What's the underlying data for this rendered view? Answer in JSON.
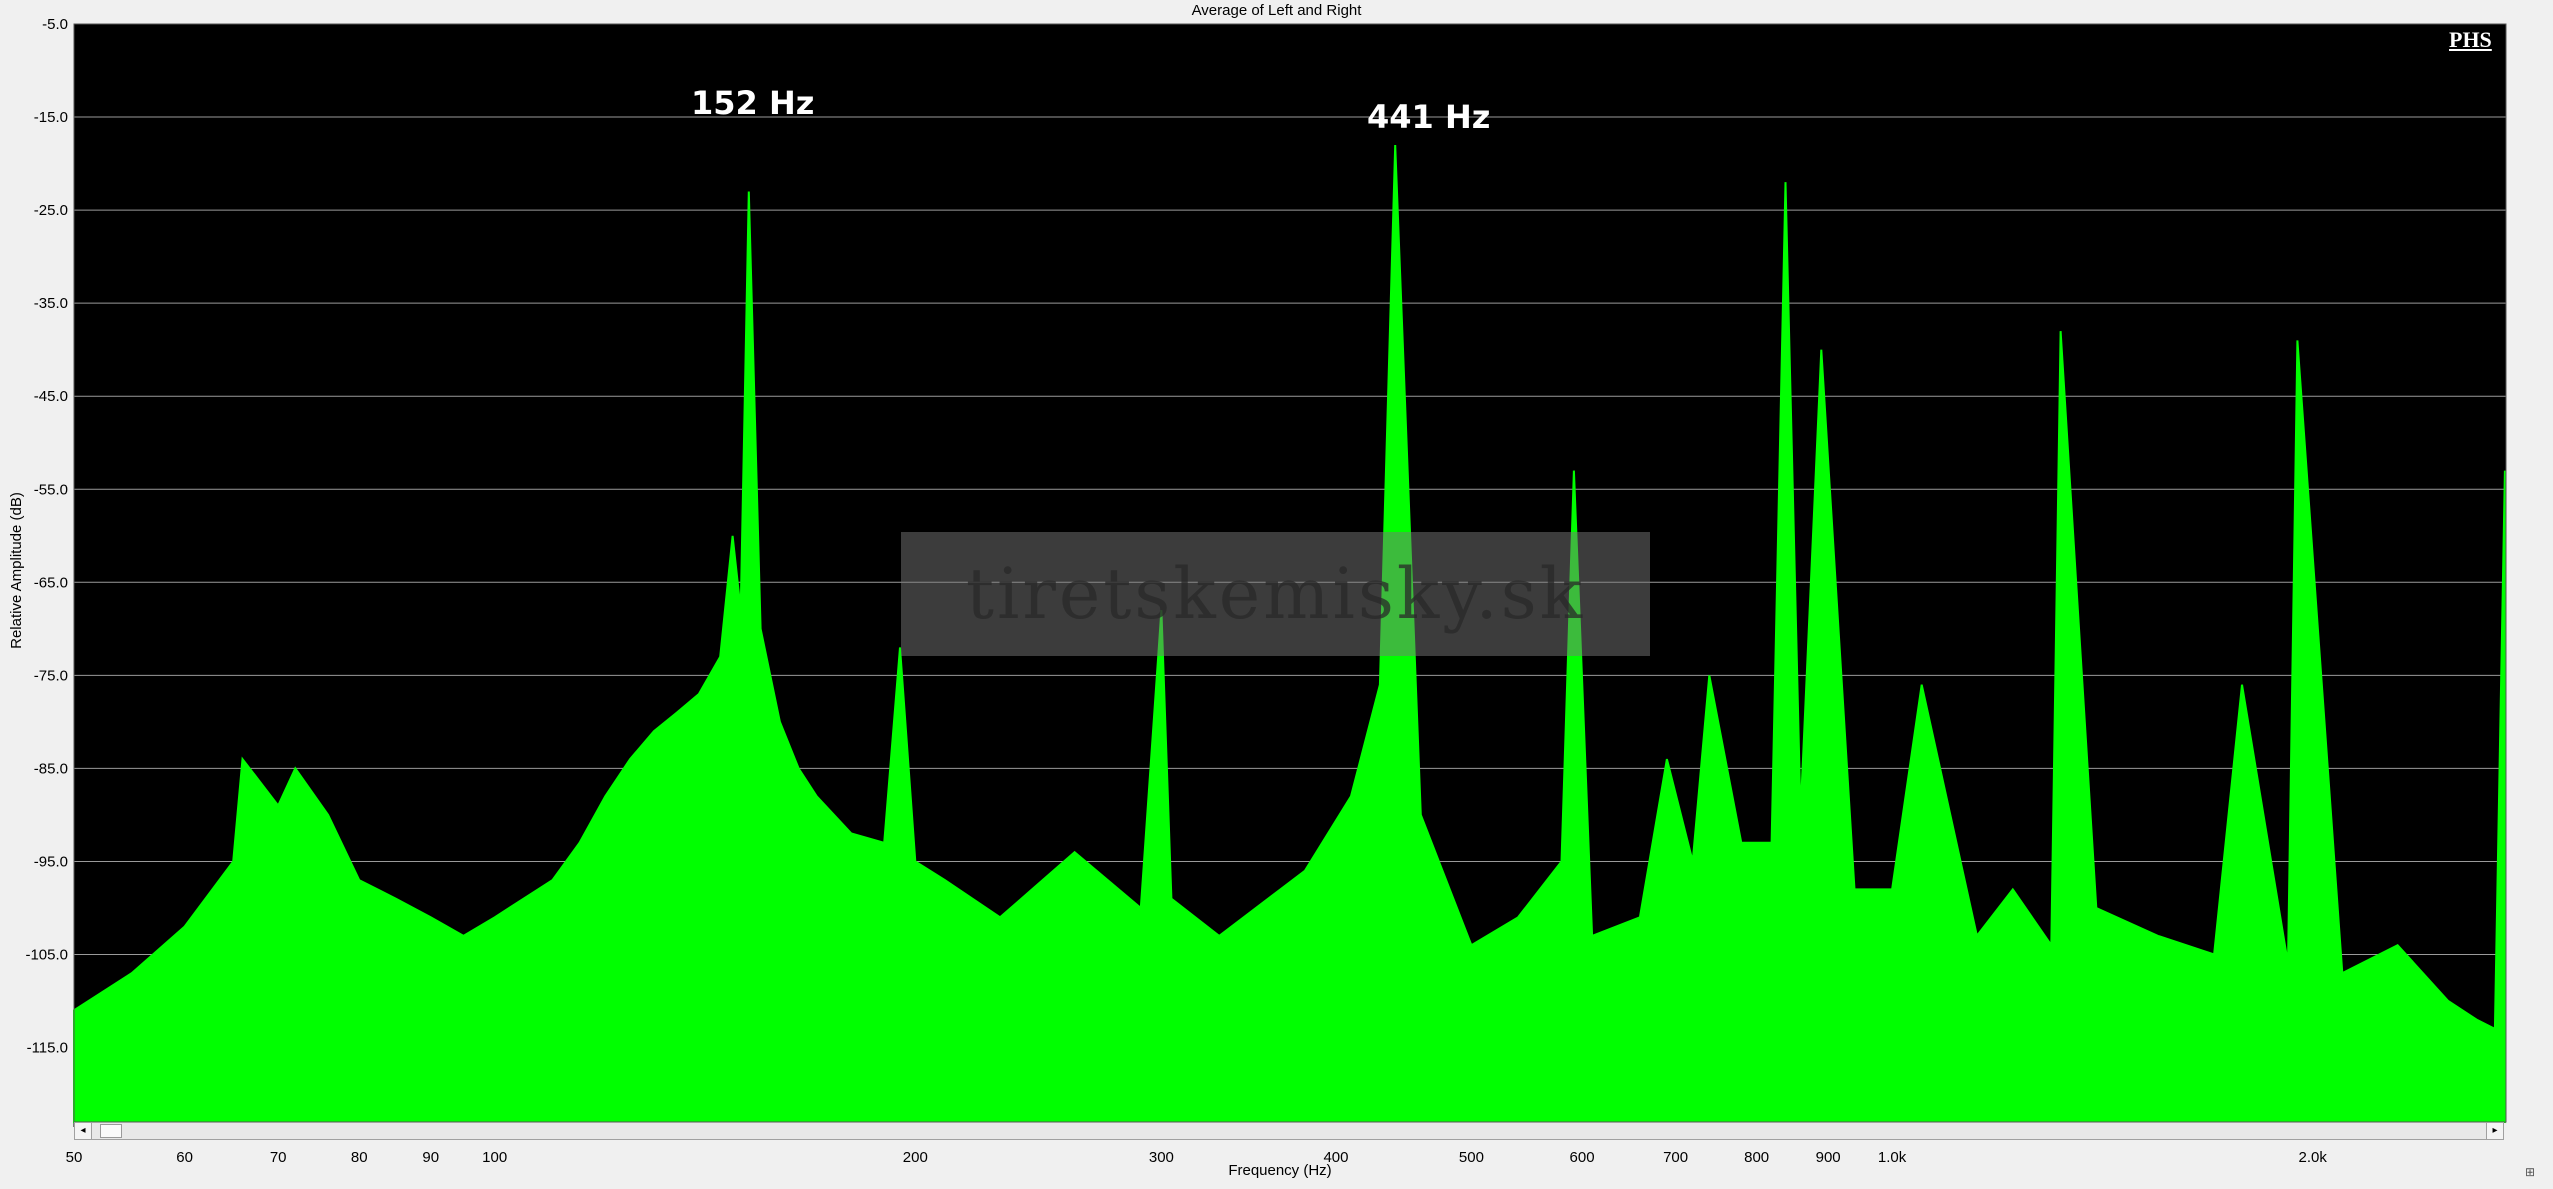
{
  "chart_data": {
    "type": "area",
    "title": "Average of Left and Right",
    "xlabel": "Frequency (Hz)",
    "ylabel": "Relative Amplitude (dB)",
    "x_scale": "log",
    "xlim": [
      50,
      2750
    ],
    "ylim": [
      -123,
      -5
    ],
    "y_ticks": [
      "-5.0",
      "-15.0",
      "-25.0",
      "-35.0",
      "-45.0",
      "-55.0",
      "-65.0",
      "-75.0",
      "-85.0",
      "-95.0",
      "-105.0",
      "-115.0"
    ],
    "x_ticks": [
      "50",
      "60",
      "70",
      "80",
      "90",
      "100",
      "200",
      "300",
      "400",
      "500",
      "600",
      "700",
      "800",
      "900",
      "1.0k",
      "2.0k"
    ],
    "grid": "horizontal",
    "series": [
      {
        "color": "#00ff00",
        "x": [
          50,
          55,
          60,
          65,
          66,
          70,
          72,
          76,
          80,
          85,
          90,
          95,
          100,
          110,
          115,
          120,
          125,
          130,
          135,
          140,
          145,
          148,
          150,
          152,
          155,
          160,
          165,
          170,
          180,
          190,
          195,
          200,
          210,
          230,
          260,
          290,
          300,
          305,
          330,
          380,
          410,
          430,
          441,
          460,
          500,
          540,
          580,
          592,
          610,
          660,
          690,
          720,
          740,
          780,
          820,
          839,
          860,
          890,
          940,
          1000,
          1050,
          1150,
          1220,
          1300,
          1320,
          1400,
          1550,
          1700,
          1780,
          1920,
          1950,
          2100,
          2300,
          2500,
          2620,
          2700,
          2745
        ],
        "y": [
          -111,
          -107,
          -102,
          -95,
          -84,
          -89,
          -85,
          -90,
          -97,
          -99,
          -101,
          -103,
          -101,
          -97,
          -93,
          -88,
          -84,
          -81,
          -79,
          -77,
          -73,
          -60,
          -68,
          -23,
          -70,
          -80,
          -85,
          -88,
          -92,
          -93,
          -72,
          -95,
          -97,
          -101,
          -94,
          -100,
          -68,
          -99,
          -103,
          -96,
          -88,
          -76,
          -18,
          -90,
          -104,
          -101,
          -95,
          -53,
          -103,
          -101,
          -84,
          -95,
          -75,
          -93,
          -93,
          -22,
          -90,
          -40,
          -98,
          -98,
          -76,
          -103,
          -98,
          -104,
          -38,
          -100,
          -103,
          -105,
          -76,
          -106,
          -39,
          -107,
          -104,
          -110,
          -112,
          -113,
          -53
        ]
      }
    ],
    "annotations": [
      "152 Hz",
      "441 Hz"
    ]
  },
  "labels": {
    "brand": "PHS",
    "watermark": "tiretskemisky.sk",
    "scroll_left": "◂",
    "scroll_right": "▸",
    "corner": "⊞"
  }
}
